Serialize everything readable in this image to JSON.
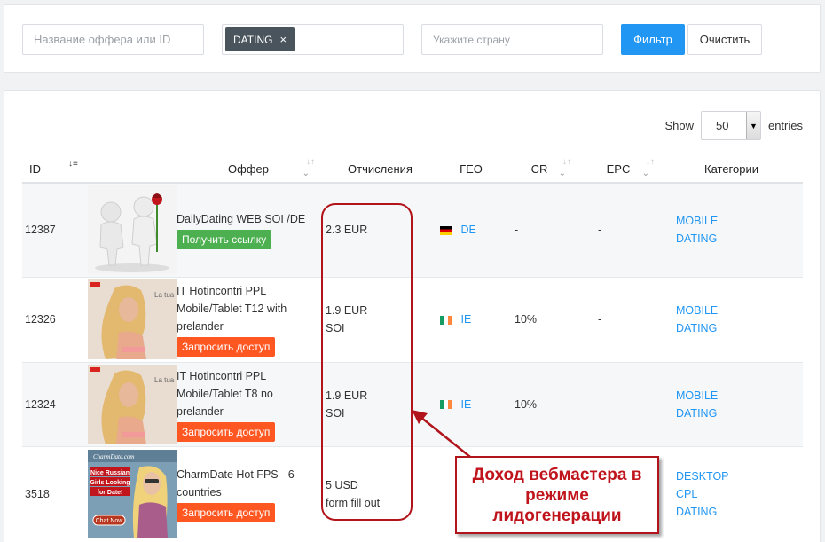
{
  "filters": {
    "name_placeholder": "Название оффера или ID",
    "category_tag": "DATING",
    "tag_remove": "×",
    "country_placeholder": "Укажите страну",
    "filter_button": "Фильтр",
    "clear_button": "Очистить"
  },
  "table_controls": {
    "show_label": "Show",
    "entries_value": "50",
    "entries_label": "entries"
  },
  "columns": {
    "id": "ID",
    "offer": "Оффер",
    "payout": "Отчисления",
    "geo": "ГЕО",
    "cr": "CR",
    "epc": "EPC",
    "categories": "Категории"
  },
  "rows": [
    {
      "id": "12387",
      "offer_name": "DailyDating WEB SOI /DE",
      "action": "Получить ссылку",
      "payout_line1": "2.3 EUR",
      "payout_line2": "",
      "geo": "DE",
      "cr": "-",
      "epc": "-",
      "categories": [
        "MOBILE",
        "DATING"
      ]
    },
    {
      "id": "12326",
      "offer_name": "IT Hotincontri PPL Mobile/Tablet T12 with prelander",
      "action": "Запросить доступ",
      "payout_line1": "1.9 EUR",
      "payout_line2": "SOI",
      "geo": "IE",
      "cr": "10%",
      "epc": "-",
      "categories": [
        "MOBILE",
        "DATING"
      ]
    },
    {
      "id": "12324",
      "offer_name": "IT Hotincontri PPL Mobile/Tablet T8 no prelander",
      "action": "Запросить доступ",
      "payout_line1": "1.9 EUR",
      "payout_line2": "SOI",
      "geo": "IE",
      "cr": "10%",
      "epc": "-",
      "categories": [
        "MOBILE",
        "DATING"
      ]
    },
    {
      "id": "3518",
      "offer_name": "CharmDate Hot FPS - 6 countries",
      "action": "Запросить доступ",
      "payout_line1": "5 USD",
      "payout_line2": "form fill out",
      "geo": "",
      "cr": "",
      "epc": "",
      "categories": [
        "DESKTOP",
        "CPL",
        "DATING"
      ]
    }
  ],
  "thumb_texts": {
    "la_tua": "La tua",
    "charm_banner": "CharmDate.com",
    "charm_line1": "Nice Russian",
    "charm_line2": "Girls Looking",
    "charm_line3": "for Date!",
    "charm_cta": "Chat Now"
  },
  "annotation": {
    "callout_text": "Доход вебмастера в режиме лидогенерации"
  },
  "colors": {
    "accent": "#2196f3",
    "get_link": "#4caf50",
    "request_access": "#ff5722",
    "annotation": "#b1141b"
  }
}
